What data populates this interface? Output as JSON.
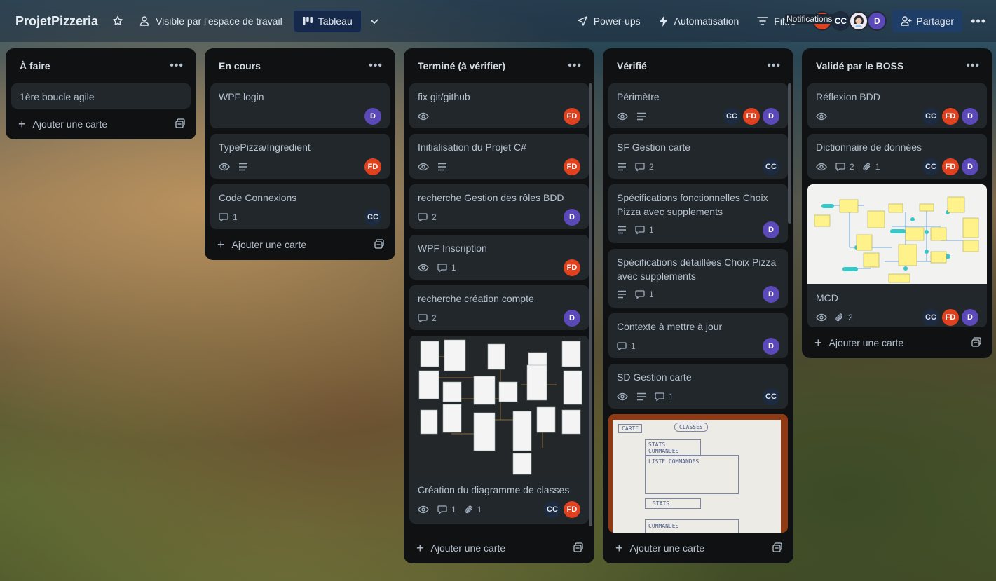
{
  "header": {
    "board_title": "ProjetPizzeria",
    "visibility": "Visible par l'espace de travail",
    "view": "Tableau",
    "powerups": "Power-ups",
    "automation": "Automatisation",
    "filter": "Filtre",
    "notifications_tooltip": "Notifications",
    "share": "Partager",
    "avatars": [
      {
        "initials": "FD",
        "color": "#e0411f"
      },
      {
        "initials": "CC",
        "color": "#1c2b41"
      },
      {
        "initials": "",
        "color": "#e9e4f0"
      },
      {
        "initials": "D",
        "color": "#5b49b9"
      }
    ]
  },
  "add_card_label": "Ajouter une carte",
  "lists": [
    {
      "title": "À faire",
      "cards": [
        {
          "title": "1ère boucle agile"
        }
      ]
    },
    {
      "title": "En cours",
      "cards": [
        {
          "title": "WPF login",
          "members": [
            "D"
          ]
        },
        {
          "title": "TypePizza/Ingredient",
          "members": [
            "FD"
          ]
        },
        {
          "title": "Code Connexions",
          "comments": "1",
          "members": [
            "CC"
          ]
        }
      ]
    },
    {
      "title": "Terminé (à vérifier)",
      "cards": [
        {
          "title": "fix git/github",
          "members": [
            "FD"
          ]
        },
        {
          "title": "Initialisation du Projet C#",
          "members": [
            "FD"
          ]
        },
        {
          "title": "recherche Gestion des rôles BDD",
          "comments": "2",
          "members": [
            "D"
          ]
        },
        {
          "title": "WPF Inscription",
          "comments": "1",
          "members": [
            "FD"
          ]
        },
        {
          "title": "recherche création compte",
          "comments": "2",
          "members": [
            "D"
          ]
        },
        {
          "title": "Création du diagramme de classes",
          "comments": "1",
          "attachments": "1",
          "members": [
            "CC",
            "FD"
          ]
        }
      ]
    },
    {
      "title": "Vérifié",
      "cards": [
        {
          "title": "Périmètre",
          "members": [
            "CC",
            "FD",
            "D"
          ]
        },
        {
          "title": "SF Gestion carte",
          "comments": "2",
          "members": [
            "CC"
          ]
        },
        {
          "title": "Spécifications fonctionnelles Choix Pizza avec supplements",
          "comments": "1",
          "members": [
            "D"
          ]
        },
        {
          "title": "Spécifications détaillées Choix Pizza avec supplements",
          "comments": "1",
          "members": [
            "D"
          ]
        },
        {
          "title": "Contexte à mettre à jour",
          "comments": "1",
          "members": [
            "D"
          ]
        },
        {
          "title": "SD Gestion carte",
          "comments": "1",
          "members": [
            "CC"
          ]
        },
        {
          "cover_lines": [
            "CARTE",
            "CLASSES",
            "STATS COMMANDES",
            "LISTE COMMANDES",
            "STATS",
            "COMMANDES"
          ]
        }
      ]
    },
    {
      "title": "Validé par le BOSS",
      "cards": [
        {
          "title": "Réflexion BDD",
          "members": [
            "CC",
            "FD",
            "D"
          ]
        },
        {
          "title": "Dictionnaire de données",
          "comments": "2",
          "attachments": "1",
          "members": [
            "CC",
            "FD",
            "D"
          ]
        },
        {
          "title": "MCD",
          "attachments": "2",
          "members": [
            "CC",
            "FD",
            "D"
          ]
        }
      ]
    }
  ]
}
